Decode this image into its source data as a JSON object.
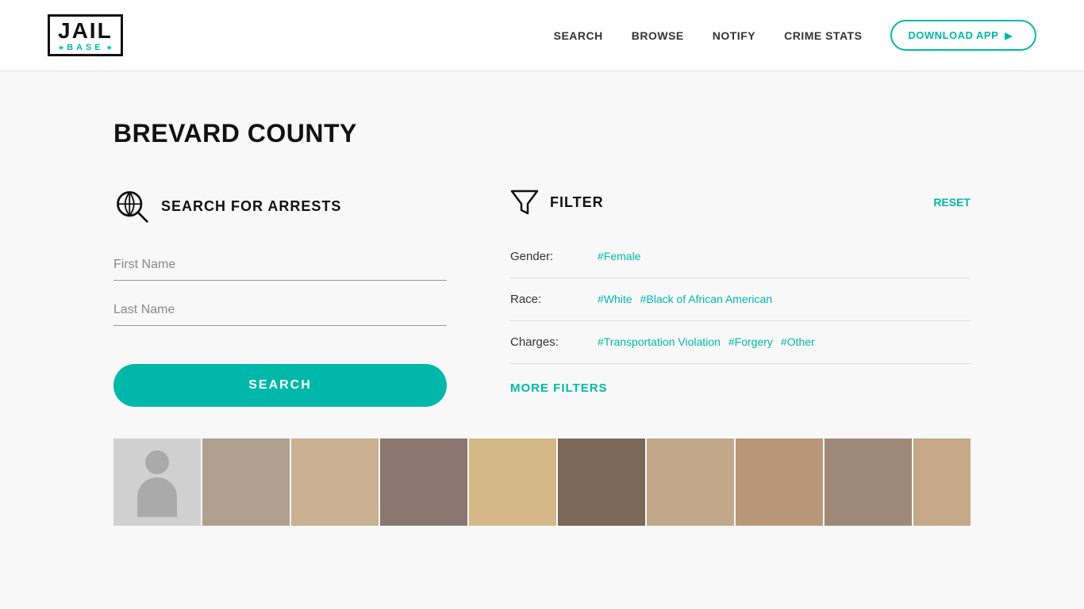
{
  "header": {
    "logo_jail": "JAIL",
    "logo_base": "BASE",
    "nav": {
      "search": "SEARCH",
      "browse": "BROWSE",
      "notify": "NOTIFY",
      "crime_stats": "CRIME STATS",
      "download_app": "DOWNLOAD APP"
    }
  },
  "page": {
    "title": "BREVARD COUNTY",
    "search_section": {
      "icon_label": "search-magnifier-icon",
      "heading": "SEARCH FOR ARRESTS",
      "first_name_placeholder": "First Name",
      "last_name_placeholder": "Last Name",
      "search_button": "SEARCH"
    },
    "filter_section": {
      "heading": "FILTER",
      "reset_label": "RESET",
      "more_filters_label": "MORE FILTERS",
      "rows": [
        {
          "label": "Gender:",
          "tags": [
            "#Female"
          ]
        },
        {
          "label": "Race:",
          "tags": [
            "#White",
            "#Black of African American"
          ]
        },
        {
          "label": "Charges:",
          "tags": [
            "#Transportation Violation",
            "#Forgery",
            "#Other"
          ]
        }
      ]
    }
  }
}
